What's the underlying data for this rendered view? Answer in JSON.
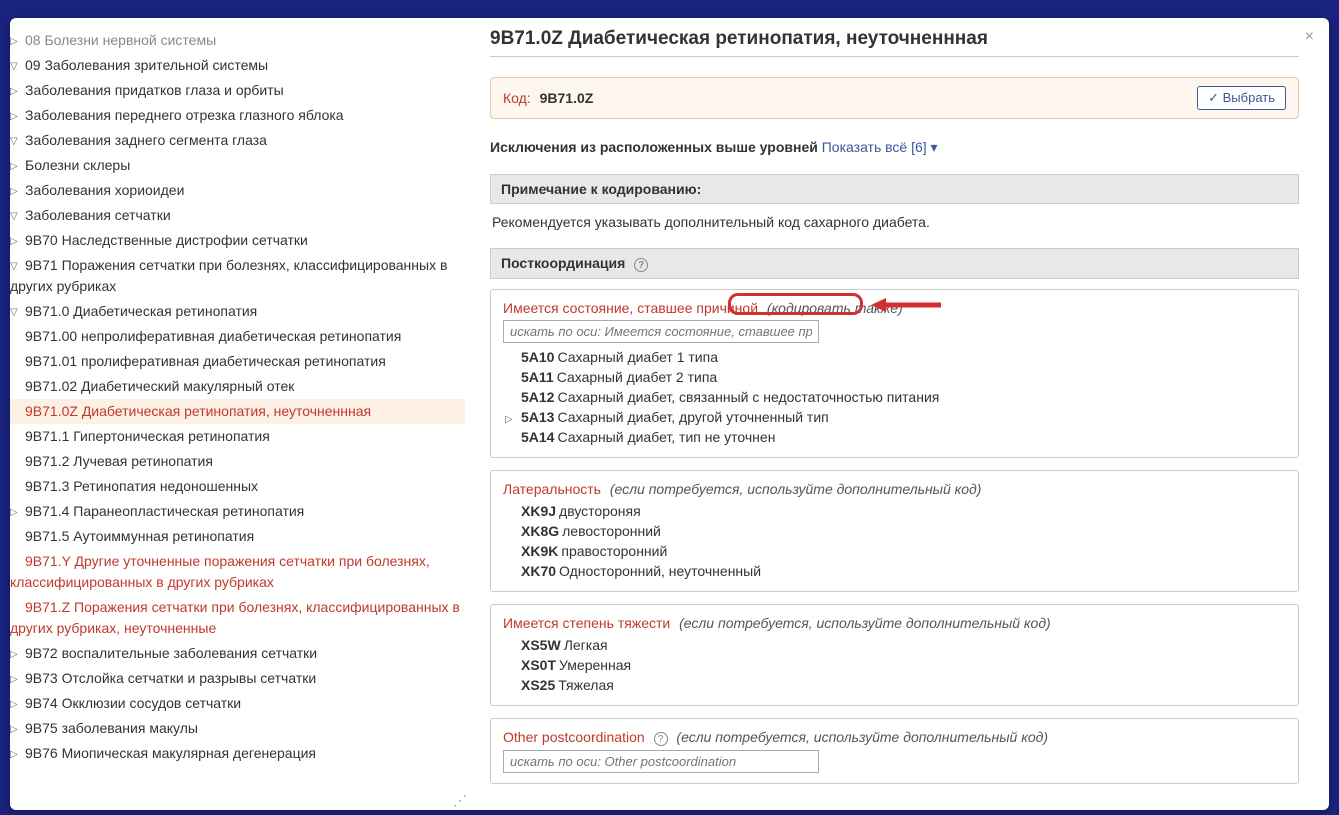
{
  "modal": {
    "close": "×"
  },
  "tree": {
    "items": [
      {
        "level": 0,
        "arrow": "▷",
        "dim": true,
        "text": "08 Болезни нервной системы"
      },
      {
        "level": 0,
        "arrow": "▽",
        "text": "09 Заболевания зрительной системы"
      },
      {
        "level": 1,
        "arrow": "▷",
        "text": "Заболевания придатков глаза и орбиты"
      },
      {
        "level": 1,
        "arrow": "▷",
        "text": "Заболевания переднего отрезка глазного яблока"
      },
      {
        "level": 1,
        "arrow": "▽",
        "text": "Заболевания заднего сегмента глаза"
      },
      {
        "level": 2,
        "arrow": "▷",
        "text": "Болезни склеры"
      },
      {
        "level": 2,
        "arrow": "▷",
        "text": "Заболевания хориоидеи"
      },
      {
        "level": 2,
        "arrow": "▽",
        "text": "Заболевания сетчатки"
      },
      {
        "level": 3,
        "arrow": "▷",
        "text": "9B70 Наследственные дистрофии сетчатки"
      },
      {
        "level": 3,
        "arrow": "▽",
        "text": "9B71 Поражения сетчатки при болезнях, классифицированных в других рубриках"
      },
      {
        "level": 4,
        "arrow": "▽",
        "text": "9B71.0 Диабетическая ретинопатия"
      },
      {
        "level": 5,
        "arrow": "",
        "text": "9B71.00 непролиферативная диабетическая ретинопатия"
      },
      {
        "level": 5,
        "arrow": "",
        "text": "9B71.01 пролиферативная диабетическая ретинопатия"
      },
      {
        "level": 5,
        "arrow": "",
        "text": "9B71.02 Диабетический макулярный отек"
      },
      {
        "level": 5,
        "arrow": "",
        "red": true,
        "selected": true,
        "text": "9B71.0Z Диабетическая ретинопатия, неуточненнная"
      },
      {
        "level": 4,
        "arrow": "",
        "text": "9B71.1 Гипертоническая ретинопатия"
      },
      {
        "level": 4,
        "arrow": "",
        "text": "9B71.2 Лучевая ретинопатия"
      },
      {
        "level": 4,
        "arrow": "",
        "text": "9B71.3 Ретинопатия недоношенных"
      },
      {
        "level": 4,
        "arrow": "▷",
        "text": "9B71.4 Паранеопластическая ретинопатия"
      },
      {
        "level": 4,
        "arrow": "",
        "text": "9B71.5 Аутоиммунная ретинопатия"
      },
      {
        "level": 4,
        "arrow": "",
        "red": true,
        "text": "9B71.Y Другие уточненные поражения сетчатки при болезнях, классифицированных в других рубриках"
      },
      {
        "level": 4,
        "arrow": "",
        "red": true,
        "text": "9B71.Z Поражения сетчатки при болезнях, классифицированных в других рубриках, неуточненные"
      },
      {
        "level": 3,
        "arrow": "▷",
        "text": "9B72 воспалительные заболевания сетчатки"
      },
      {
        "level": 3,
        "arrow": "▷",
        "text": "9B73 Отслойка сетчатки и разрывы сетчатки"
      },
      {
        "level": 3,
        "arrow": "▷",
        "text": "9B74 Окклюзии сосудов сетчатки"
      },
      {
        "level": 3,
        "arrow": "▷",
        "text": "9B75 заболевания макулы"
      },
      {
        "level": 3,
        "arrow": "▷",
        "text": "9B76 Миопическая макулярная дегенерация"
      }
    ]
  },
  "right": {
    "title": "9B71.0Z Диабетическая ретинопатия, неуточненнная",
    "code_label": "Код:",
    "code_value": "9B71.0Z",
    "select_btn": "✓ Выбрать",
    "exclusions_label": "Исключения из расположенных выше уровней",
    "exclusions_link": "Показать всё [6] ▾",
    "coding_note_header": "Примечание к кодированию:",
    "coding_note_text": "Рекомендуется указывать дополнительный код сахарного диабета.",
    "postcoord_header": "Посткоординация",
    "help": "?",
    "axis1": {
      "title": "Имеется состояние, ставшее причиной",
      "note": "(кодировать также)",
      "search_placeholder": "искать по оси: Имеется состояние, ставшее причин",
      "items": [
        {
          "code": "5A10",
          "label": "Сахарный диабет 1 типа"
        },
        {
          "code": "5A11",
          "label": "Сахарный диабет 2 типа"
        },
        {
          "code": "5A12",
          "label": "Сахарный диабет, связанный с недостаточностью питания"
        },
        {
          "code": "5A13",
          "label": "Сахарный диабет, другой уточненный тип",
          "expandable": true
        },
        {
          "code": "5A14",
          "label": "Сахарный диабет, тип не уточнен"
        }
      ]
    },
    "axis2": {
      "title": "Латеральность",
      "note": "(если потребуется, используйте дополнительный код)",
      "items": [
        {
          "code": "XK9J",
          "label": "двустороняя"
        },
        {
          "code": "XK8G",
          "label": "левосторонний"
        },
        {
          "code": "XK9K",
          "label": "правосторонний"
        },
        {
          "code": "XK70",
          "label": "Односторонний, неуточненный"
        }
      ]
    },
    "axis3": {
      "title": "Имеется степень тяжести",
      "note": "(если потребуется, используйте дополнительный код)",
      "items": [
        {
          "code": "XS5W",
          "label": "Легкая"
        },
        {
          "code": "XS0T",
          "label": "Умеренная"
        },
        {
          "code": "XS25",
          "label": "Тяжелая"
        }
      ]
    },
    "axis4": {
      "title": "Other postcoordination",
      "note": "(если потребуется, используйте дополнительный код)",
      "search_placeholder": "искать по оси: Other postcoordination",
      "help": "?"
    }
  }
}
